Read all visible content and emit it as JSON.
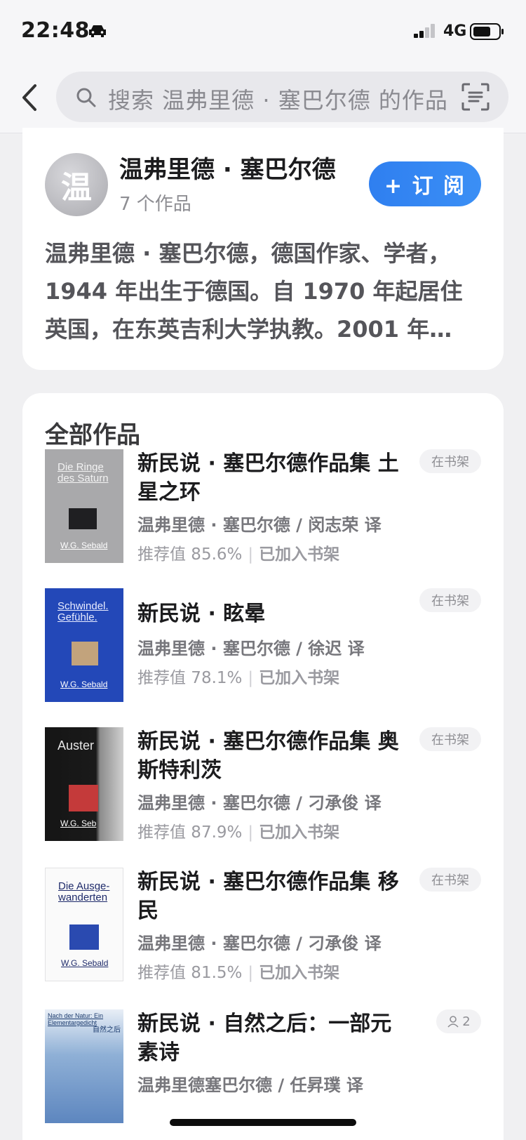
{
  "status": {
    "time": "22:48",
    "network": "4G"
  },
  "search": {
    "placeholder": "搜索 温弗里德 · 塞巴尔德 的作品"
  },
  "author": {
    "avatar_char": "温",
    "name": "温弗里德 · 塞巴尔德",
    "works_count": "7 个作品",
    "subscribe_label": "+ 订 阅",
    "bio": "温弗里德 · 塞巴尔德，德国作家、学者，1944 年出生于德国。自 1970 年起居住英国，在东英吉利大学执教。2001 年…"
  },
  "works": {
    "section_title": "全部作品",
    "books": [
      {
        "title": "新民说 · 塞巴尔德作品集 土星之环",
        "author_line": "温弗里德 · 塞巴尔德 / 闵志荣 译",
        "rating": "推荐值 85.6%",
        "shelf_status": "已加入书架",
        "badge": "在书架",
        "cover_title": "Die Ringe des Saturn",
        "cover_author": "W.G. Sebald"
      },
      {
        "title": "新民说 · 眩晕",
        "author_line": "温弗里德 · 塞巴尔德 / 徐迟 译",
        "rating": "推荐值 78.1%",
        "shelf_status": "已加入书架",
        "badge": "在书架",
        "cover_title": "Schwindel. Gefühle.",
        "cover_author": "W.G. Sebald"
      },
      {
        "title": "新民说 · 塞巴尔德作品集 奥斯特利茨",
        "author_line": "温弗里德 · 塞巴尔德 / 刁承俊 译",
        "rating": "推荐值 87.9%",
        "shelf_status": "已加入书架",
        "badge": "在书架",
        "cover_title": "Auster",
        "cover_author": "W.G. Seb"
      },
      {
        "title": "新民说 · 塞巴尔德作品集 移民",
        "author_line": "温弗里德 · 塞巴尔德 / 刁承俊 译",
        "rating": "推荐值 81.5%",
        "shelf_status": "已加入书架",
        "badge": "在书架",
        "cover_title": "Die Ausge- wanderten",
        "cover_author": "W.G. Sebald"
      },
      {
        "title": "新民说 · 自然之后：一部元素诗",
        "author_line": "温弗里德塞巴尔德 / 任昇璞 译",
        "badge": "2",
        "cover_title": "Nach der Natur: Ein Elementargedicht",
        "cover_sub": "自然之后"
      }
    ]
  },
  "colors": {
    "accent": "#3385f2",
    "card": "#ffffff",
    "background": "#f0f0f2"
  }
}
